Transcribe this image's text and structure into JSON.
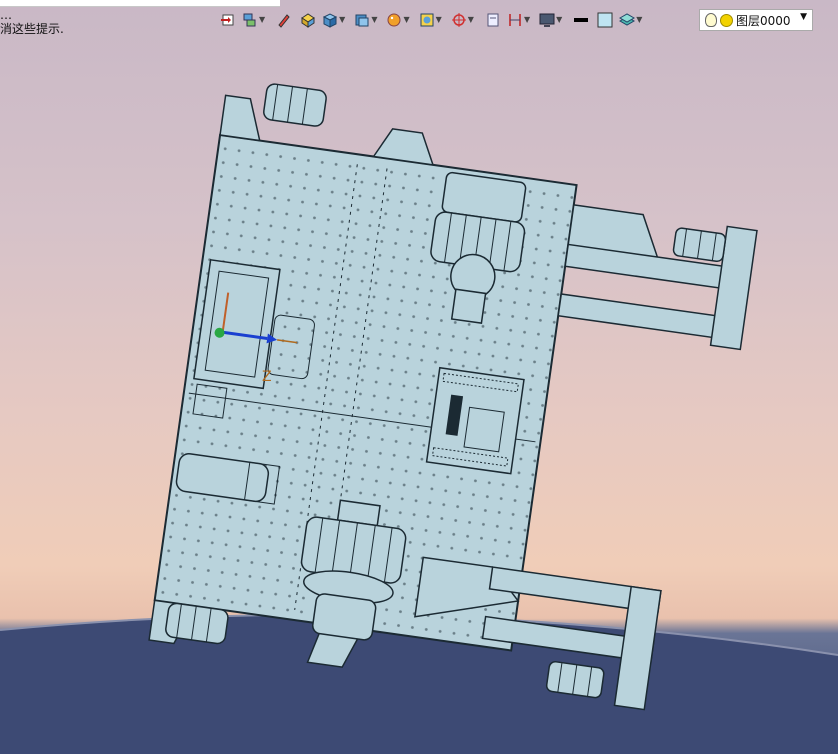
{
  "app": {
    "hint_line1": "…",
    "hint_line2": "消这些提示."
  },
  "toolbar": {
    "items": [
      {
        "icon": "import-icon",
        "dropdown": false
      },
      {
        "icon": "layer-stack-icon",
        "dropdown": true
      },
      {
        "icon": "pencil-icon",
        "dropdown": false
      },
      {
        "icon": "box-solid-icon",
        "dropdown": false
      },
      {
        "icon": "cube-icon",
        "dropdown": true
      },
      {
        "icon": "view-cube-icon",
        "dropdown": true
      },
      {
        "icon": "render-sphere-icon",
        "dropdown": true
      },
      {
        "icon": "frame-icon",
        "dropdown": true
      },
      {
        "icon": "target-icon",
        "dropdown": true
      },
      {
        "icon": "page-icon",
        "dropdown": false
      },
      {
        "icon": "dimension-icon",
        "dropdown": true
      },
      {
        "icon": "monitor-icon",
        "dropdown": true
      },
      {
        "icon": "line-color-icon",
        "dropdown": false
      },
      {
        "icon": "fill-color-icon",
        "dropdown": false
      },
      {
        "icon": "material-icon",
        "dropdown": true
      }
    ],
    "layer_selector": {
      "label": "图层0000"
    }
  },
  "viewport": {
    "axis_label": "Z",
    "colors": {
      "part": "#b9d3dc",
      "edge": "#1b2a33",
      "ground": "#3d4a74",
      "sky": "#d6c2c9"
    }
  }
}
